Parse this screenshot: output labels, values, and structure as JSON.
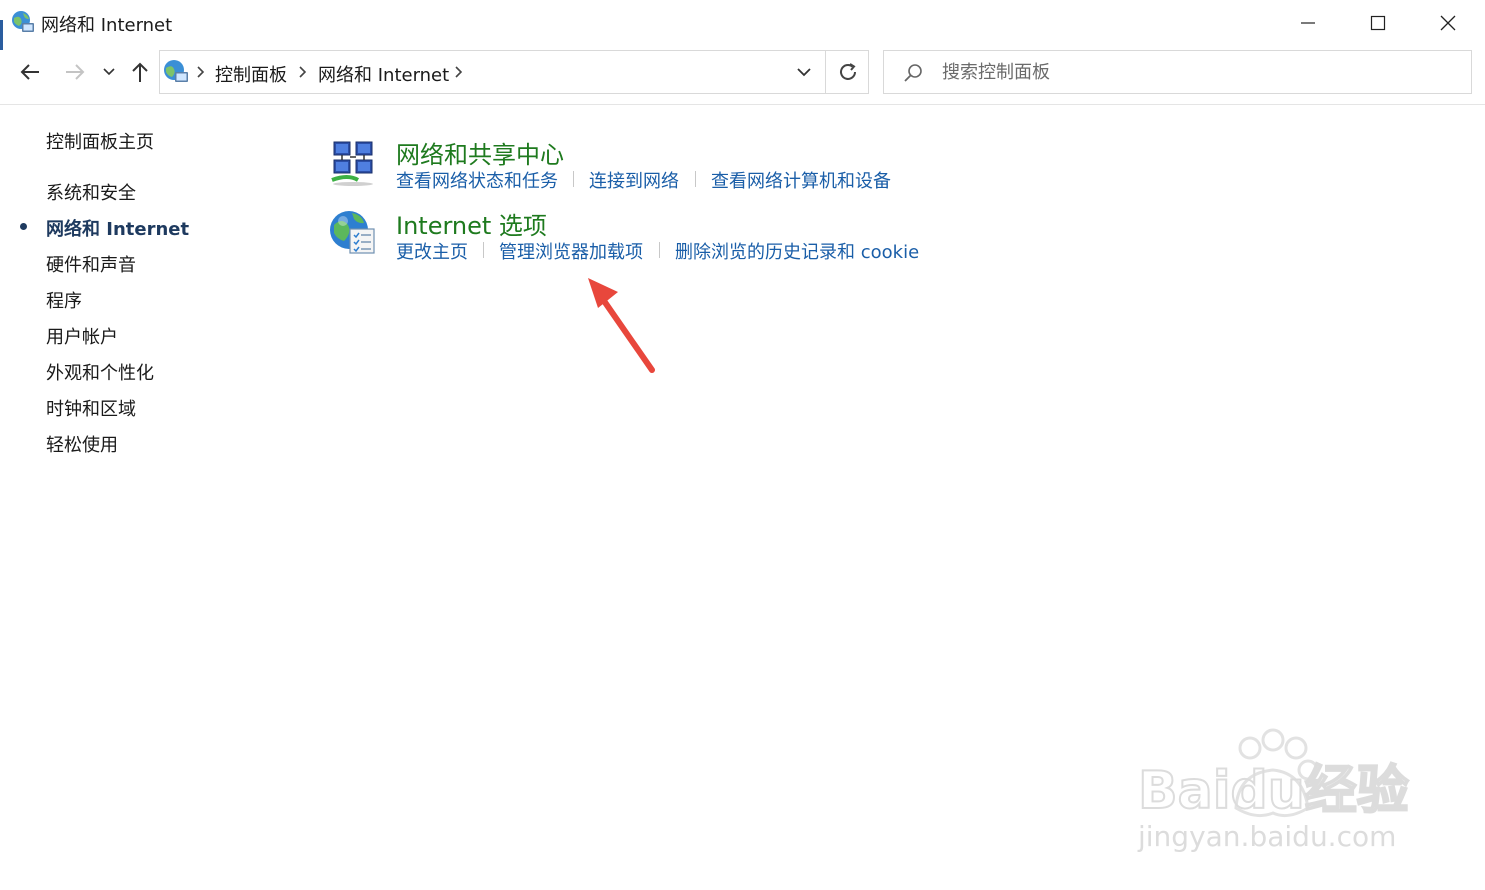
{
  "window": {
    "title": "网络和 Internet"
  },
  "breadcrumb": {
    "items": [
      "控制面板",
      "网络和 Internet"
    ]
  },
  "search": {
    "placeholder": "搜索控制面板"
  },
  "sidebar": {
    "items": [
      {
        "label": "控制面板主页"
      },
      {
        "label": "系统和安全"
      },
      {
        "label": "网络和 Internet",
        "active": true
      },
      {
        "label": "硬件和声音"
      },
      {
        "label": "程序"
      },
      {
        "label": "用户帐户"
      },
      {
        "label": "外观和个性化"
      },
      {
        "label": "时钟和区域"
      },
      {
        "label": "轻松使用"
      }
    ]
  },
  "categories": [
    {
      "title": "网络和共享中心",
      "icon": "network-sharing-icon",
      "links": [
        "查看网络状态和任务",
        "连接到网络",
        "查看网络计算机和设备"
      ]
    },
    {
      "title": "Internet 选项",
      "icon": "internet-options-icon",
      "links": [
        "更改主页",
        "管理浏览器加载项",
        "删除浏览的历史记录和 cookie"
      ]
    }
  ],
  "watermark": {
    "brand": "Baidu经验",
    "url": "jingyan.baidu.com"
  },
  "colors": {
    "title_green": "#1e7a1e",
    "link_blue": "#1a5ea8",
    "active_navy": "#1e3a5f",
    "arrow_red": "#e8473c"
  }
}
